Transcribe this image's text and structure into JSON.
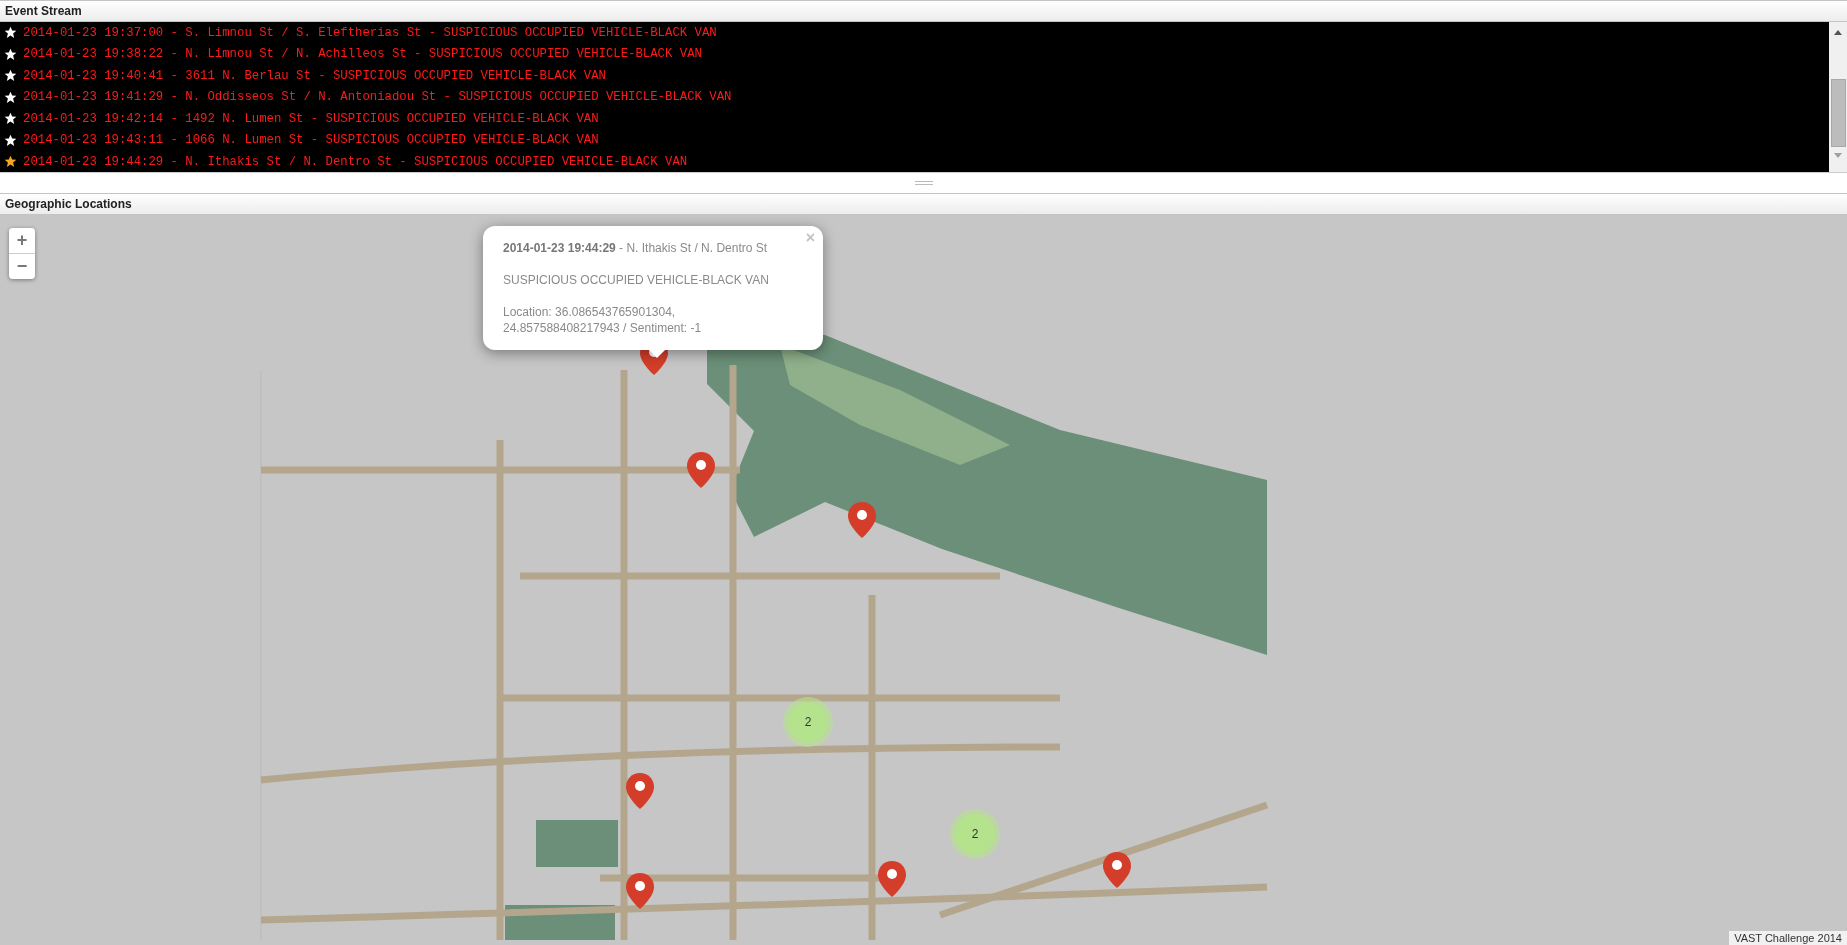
{
  "event_stream": {
    "title": "Event Stream",
    "events": [
      {
        "text": "2014-01-23 19:37:00 - S. Limnou St / S. Eleftherias St - SUSPICIOUS OCCUPIED VEHICLE-BLACK VAN",
        "selected": false
      },
      {
        "text": "2014-01-23 19:38:22 - N. Limnou St / N. Achilleos St - SUSPICIOUS OCCUPIED VEHICLE-BLACK VAN",
        "selected": false
      },
      {
        "text": "2014-01-23 19:40:41 - 3611 N. Berlau St - SUSPICIOUS OCCUPIED VEHICLE-BLACK VAN",
        "selected": false
      },
      {
        "text": "2014-01-23 19:41:29 - N. Oddisseos St / N. Antoniadou St - SUSPICIOUS OCCUPIED VEHICLE-BLACK VAN",
        "selected": false
      },
      {
        "text": "2014-01-23 19:42:14 - 1492 N. Lumen St - SUSPICIOUS OCCUPIED VEHICLE-BLACK VAN",
        "selected": false
      },
      {
        "text": "2014-01-23 19:43:11 - 1066 N. Lumen St - SUSPICIOUS OCCUPIED VEHICLE-BLACK VAN",
        "selected": false
      },
      {
        "text": "2014-01-23 19:44:29 - N. Ithakis St / N. Dentro St - SUSPICIOUS OCCUPIED VEHICLE-BLACK VAN",
        "selected": true
      }
    ]
  },
  "map": {
    "title": "Geographic Locations",
    "zoom_in": "+",
    "zoom_out": "−",
    "popup": {
      "close": "×",
      "heading": "**2014-01-23 19:44:29** - N. Ithakis St / N. Dentro St",
      "description": "SUSPICIOUS OCCUPIED VEHICLE-BLACK VAN",
      "location": "Location: 36.086543765901304, 24.857588408217943 / Sentiment: -1"
    },
    "clusters": [
      {
        "count": "2"
      },
      {
        "count": "2"
      }
    ],
    "attribution": "VAST Challenge 2014"
  }
}
